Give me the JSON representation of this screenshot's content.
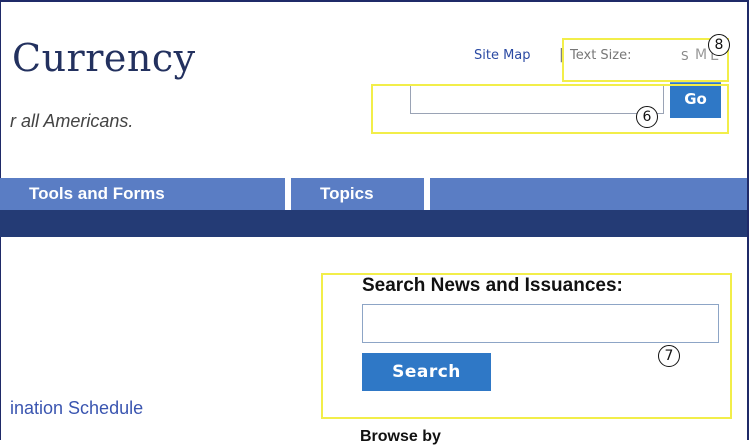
{
  "header": {
    "title": "Currency",
    "subtitle": "r all Americans.",
    "site_map": "Site Map",
    "separator": "|",
    "text_size_label": "Text Size:",
    "size_small": "S",
    "size_medium": "M",
    "size_large": "L"
  },
  "top_search": {
    "go_label": "Go"
  },
  "nav": {
    "items": [
      {
        "label": "Tools and Forms"
      },
      {
        "label": "Topics"
      }
    ]
  },
  "search_news": {
    "title": "Search News and Issuances:",
    "button_label": "Search"
  },
  "content": {
    "schedule_link": "ination Schedule",
    "bottom_partial": "Browse by"
  },
  "annotations": {
    "six": "6",
    "seven": "7",
    "eight": "8"
  },
  "colors": {
    "nav_bar": "#5a7dc4",
    "sub_bar": "#243b75",
    "button": "#2f78c6",
    "annotation": "#f2ee4a"
  }
}
